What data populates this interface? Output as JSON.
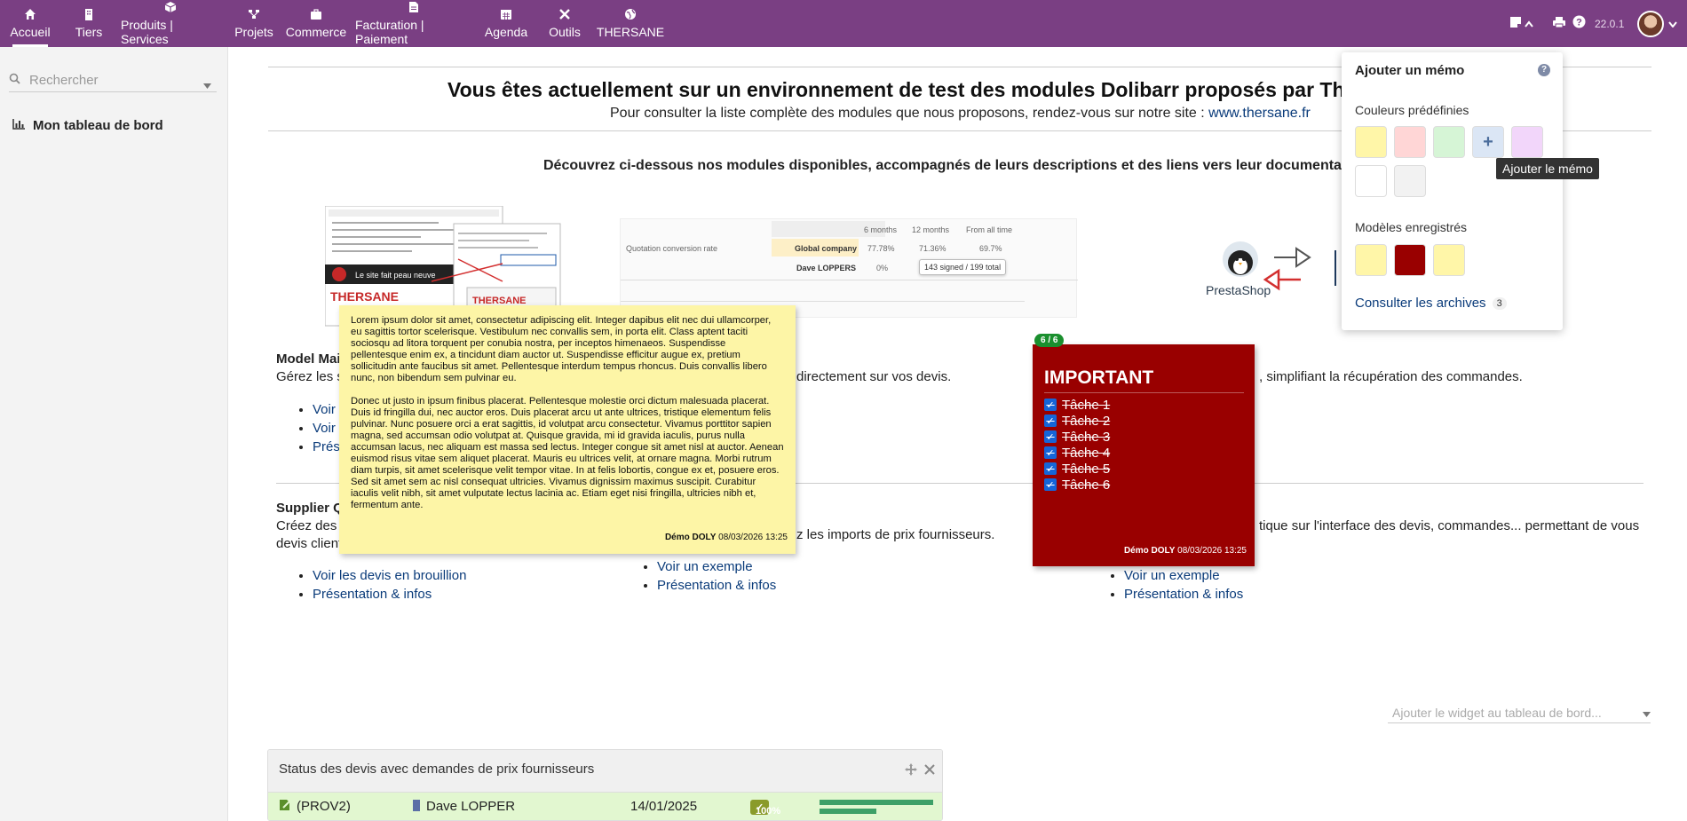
{
  "topbar": {
    "nav": [
      {
        "label": "Accueil",
        "icon": "home-icon"
      },
      {
        "label": "Tiers",
        "icon": "building-icon"
      },
      {
        "label": "Produits | Services",
        "icon": "cube-icon"
      },
      {
        "label": "Projets",
        "icon": "sitemap-icon"
      },
      {
        "label": "Commerce",
        "icon": "briefcase-icon"
      },
      {
        "label": "Facturation | Paiement",
        "icon": "invoice-icon"
      },
      {
        "label": "Agenda",
        "icon": "calendar-icon"
      },
      {
        "label": "Outils",
        "icon": "tools-icon"
      },
      {
        "label": "THERSANE",
        "icon": "globe-icon"
      }
    ],
    "version": "22.0.1"
  },
  "sidebar": {
    "search_placeholder": "Rechercher",
    "dashboard_label": "Mon tableau de bord"
  },
  "main": {
    "headline": "Vous êtes actuellement sur un environnement de test des modules Dolibarr proposés par Thersane",
    "subline_text": "Pour consulter la liste complète des modules que nous proposons, rendez-vous sur notre site : ",
    "subline_link": "www.thersane.fr",
    "discover": "Découvrez ci-dessous nos modules disponibles, accompagnés de leurs descriptions et des liens vers leur documentation",
    "thumb_table": {
      "headers": [
        "6 months",
        "12 months",
        "From all time"
      ],
      "row_label": "Quotation conversion rate",
      "rows": [
        {
          "name": "Global company",
          "values": [
            "77.78%",
            "71.36%",
            "69.7%"
          ]
        },
        {
          "name": "Dave LOPPERS",
          "values": [
            "0%"
          ]
        }
      ],
      "tooltip": "143 signed / 199 total"
    },
    "presta_label": "PrestaShop",
    "module1": {
      "title": "Model Mai",
      "text_left": "Gérez les s",
      "text_right": "directement sur vos devis.",
      "links": [
        "Voir",
        "Voir",
        "Prés"
      ]
    },
    "module3_text": ", simplifiant la récupération des commandes.",
    "module4": {
      "title": "Supplier Q",
      "text": "Créez des",
      "text_line2": "devis client",
      "links": [
        "Voir les devis en brouillion",
        "Présentation & infos"
      ]
    },
    "module5": {
      "text": "z les imports de prix fournisseurs.",
      "links": [
        "Voir un exemple",
        "Présentation & infos"
      ]
    },
    "module6": {
      "text": "tique sur l'interface des devis, commandes... permettant de vous",
      "links": [
        "Voir un exemple",
        "Présentation & infos"
      ]
    }
  },
  "memo_yellow": {
    "para1": "Lorem ipsum dolor sit amet, consectetur adipiscing elit. Integer dapibus elit nec dui ullamcorper, eu sagittis tortor scelerisque. Vestibulum nec convallis sem, in porta elit. Class aptent taciti sociosqu ad litora torquent per conubia nostra, per inceptos himenaeos. Suspendisse pellentesque enim ex, a tincidunt diam auctor ut. Suspendisse efficitur augue ex, pretium sollicitudin ante faucibus sit amet. Pellentesque interdum tempus rhoncus. Duis convallis libero nunc, non bibendum sem pulvinar eu.",
    "para2": "Donec ut justo in ipsum finibus placerat. Pellentesque molestie orci dictum malesuada placerat. Duis id fringilla dui, nec auctor eros. Duis placerat arcu ut ante ultrices, tristique elementum felis pulvinar. Nunc posuere orci a erat sagittis, id volutpat arcu consectetur. Vivamus porttitor sapien magna, sed accumsan odio volutpat at. Quisque gravida, mi id gravida iaculis, purus nulla accumsan lacus, nec aliquam est massa sed lectus. Integer congue sit amet nisl at auctor. Aenean euismod risus vitae sem aliquet placerat. Mauris eu ultrices velit, at ornare magna. Morbi rutrum diam turpis, sit amet scelerisque velit tempor vitae. In at felis lobortis, congue ex et, posuere eros. Sed sit amet sem ac nisl consequat ultricies. Vivamus dignissim maximus suscipit. Curabitur iaculis velit nibh, sit amet vulputate lectus lacinia ac. Etiam eget nisi fringilla, ultricies nibh et, fermentum ante.",
    "author": "Démo DOLY",
    "date": "08/03/2026 13:25"
  },
  "memo_red": {
    "badge": "6 / 6",
    "title": "IMPORTANT",
    "tasks": [
      "Tâche 1",
      "Tâche 2",
      "Tâche 3",
      "Tâche 4",
      "Tâche 5",
      "Tâche 6"
    ],
    "author": "Démo DOLY",
    "date": "08/03/2026 13:25"
  },
  "popup": {
    "title": "Ajouter un mémo",
    "help": "?",
    "predef_label": "Couleurs prédéfinies",
    "predef_colors": [
      "#fff6a8",
      "#ffd6d6",
      "#d6f5d6",
      "#dbe6f5",
      "#f2d6fa",
      "#ffffff",
      "#f2f2f2"
    ],
    "add_symbol": "+",
    "saved_label": "Modèles enregistrés",
    "saved_colors": [
      "#fff6a8",
      "#990000",
      "#fff6a8"
    ],
    "archives_label": "Consulter les archives",
    "archives_count": "3",
    "tooltip": "Ajouter le mémo"
  },
  "widget_select_placeholder": "Ajouter le widget au tableau de bord...",
  "statusbox": {
    "title": "Status des devis avec demandes de prix fournisseurs",
    "row": {
      "ref": "(PROV2)",
      "client": "Dave LOPPER",
      "date": "14/01/2025",
      "percent": "100%"
    }
  },
  "colors": {
    "brand": "#7a3f83",
    "link": "#0a3b7a",
    "memo_yellow": "#fdf5a6",
    "memo_red": "#990000"
  }
}
